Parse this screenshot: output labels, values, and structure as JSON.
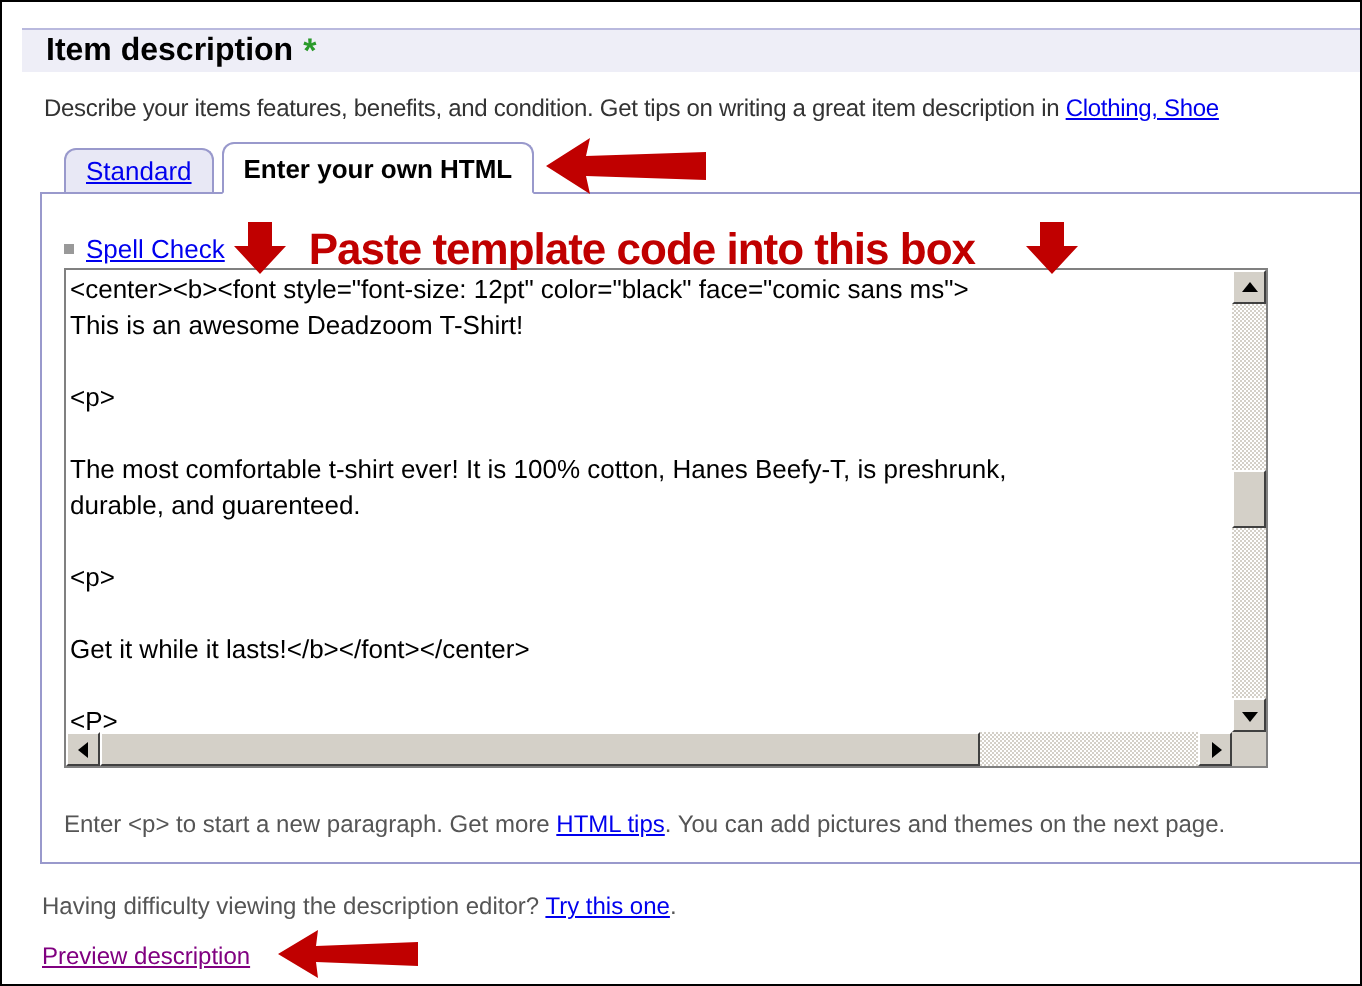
{
  "section": {
    "title": "Item description",
    "required_mark": "*",
    "intro": "Describe your items features, benefits, and condition. Get tips on writing a great item description in",
    "intro_link": "Clothing, Shoe"
  },
  "tabs": [
    {
      "label": "Standard",
      "selected": false
    },
    {
      "label": "Enter your own HTML",
      "selected": true
    }
  ],
  "spell_check": "Spell Check",
  "annotation": "Paste template code into this box",
  "editor": {
    "value": "<center><b><font style=\"font-size: 12pt\" color=\"black\" face=\"comic sans ms\">\nThis is an awesome Deadzoom T-Shirt!\n\n<p>\n\nThe most comfortable t-shirt ever! It is 100% cotton, Hanes Beefy-T, is preshrunk,\ndurable, and guarenteed.\n\n<p>\n\nGet it while it lasts!</b></font></center>\n\n<P>"
  },
  "hint": {
    "before": "Enter <p> to start a new paragraph. Get more",
    "link": "HTML tips",
    "after": ". You can add pictures and themes on the next page."
  },
  "help": {
    "text": "Having difficulty viewing the description editor?",
    "link": "Try this one",
    "after": "."
  },
  "preview_link": "Preview description"
}
